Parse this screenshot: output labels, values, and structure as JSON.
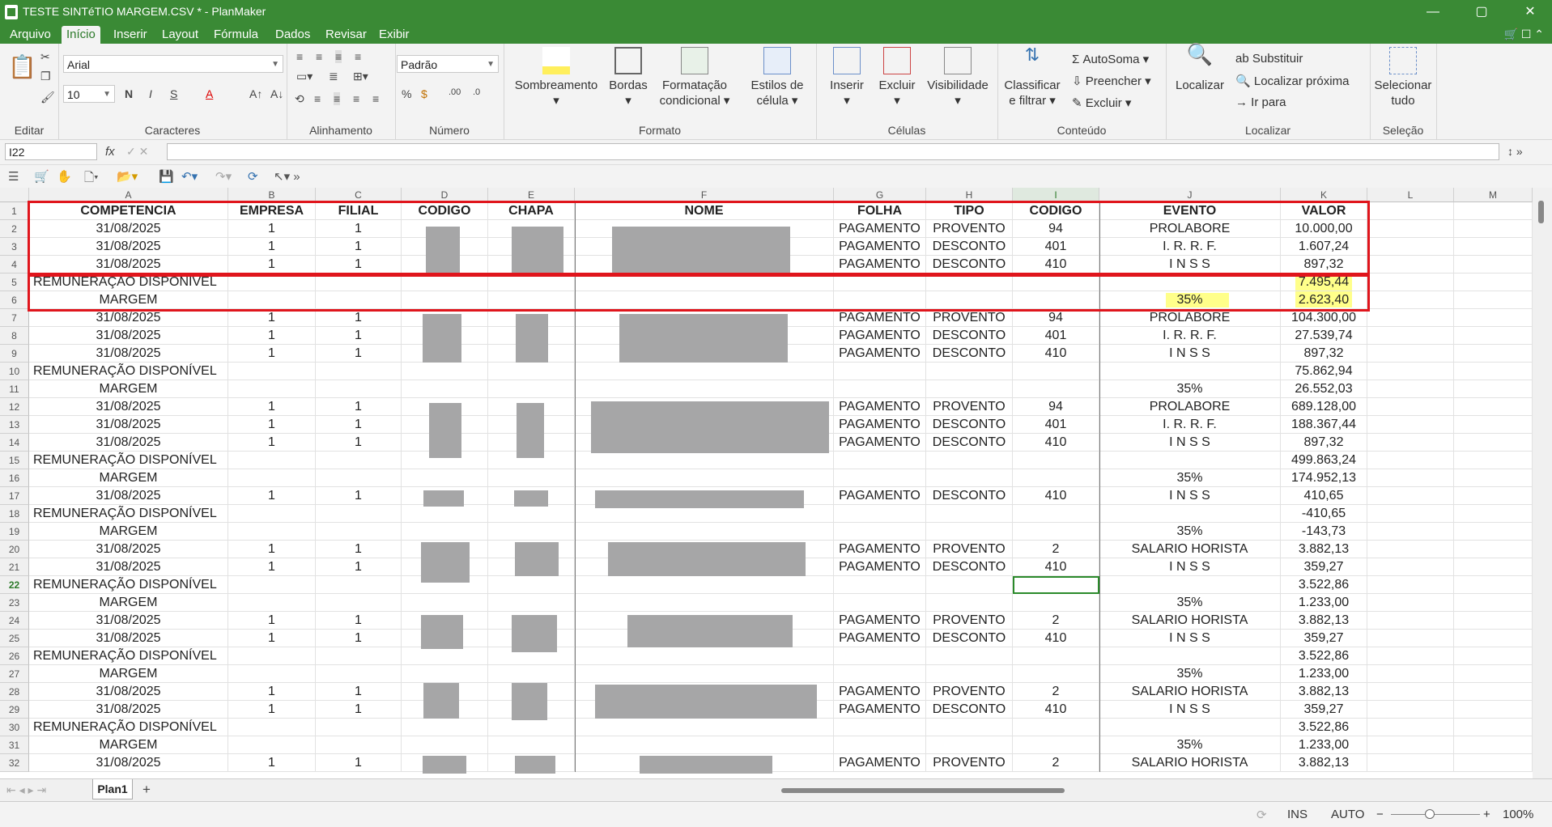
{
  "window": {
    "title": "TESTE SINTéTIO MARGEM.CSV * - PlanMaker"
  },
  "menu": {
    "tabs": [
      "Arquivo",
      "Início",
      "Inserir",
      "Layout",
      "Fórmula",
      "Dados",
      "Revisar",
      "Exibir"
    ],
    "active": "Início"
  },
  "ribbon": {
    "font_name": "Arial",
    "font_size": "10",
    "number_format": "Padrão",
    "buttons": {
      "shading": "Sombreamento",
      "borders": "Bordas",
      "cond_format_1": "Formatação",
      "cond_format_2": "condicional",
      "cell_styles_1": "Estilos de",
      "cell_styles_2": "célula",
      "insert": "Inserir",
      "delete": "Excluir",
      "visibility": "Visibilidade",
      "sort_1": "Classificar",
      "sort_2": "e filtrar",
      "autosum": "AutoSoma",
      "fill": "Preencher",
      "clear": "Excluir",
      "find": "Localizar",
      "replace": "Substituir",
      "find_next": "Localizar próxima",
      "goto": "Ir para",
      "select_all_1": "Selecionar",
      "select_all_2": "tudo"
    },
    "groups": [
      "Editar",
      "Caracteres",
      "Alinhamento",
      "Número",
      "Formato",
      "Células",
      "Conteúdo",
      "Localizar",
      "Seleção"
    ]
  },
  "formula_bar": {
    "cell_ref": "I22",
    "fx": "fx",
    "content": ""
  },
  "sheet": {
    "columns": [
      "A",
      "B",
      "C",
      "D",
      "E",
      "F",
      "G",
      "H",
      "I",
      "J",
      "K",
      "L",
      "M"
    ],
    "selected_column": "I",
    "selected_row": "22",
    "header": [
      "COMPETENCIA",
      "EMPRESA",
      "FILIAL",
      "CODIGO",
      "CHAPA",
      "NOME",
      "FOLHA",
      "TIPO",
      "CODIGO",
      "EVENTO",
      "VALOR"
    ],
    "rows": [
      {
        "n": "2",
        "type": "d",
        "a": "31/08/2025",
        "b": "1",
        "c": "1",
        "g": "PAGAMENTO",
        "h": "PROVENTO",
        "i": "94",
        "j": "PROLABORE",
        "k": "10.000,00"
      },
      {
        "n": "3",
        "type": "d",
        "a": "31/08/2025",
        "b": "1",
        "c": "1",
        "g": "PAGAMENTO",
        "h": "DESCONTO",
        "i": "401",
        "j": "I. R. R. F.",
        "k": "1.607,24"
      },
      {
        "n": "4",
        "type": "d",
        "a": "31/08/2025",
        "b": "1",
        "c": "1",
        "g": "PAGAMENTO",
        "h": "DESCONTO",
        "i": "410",
        "j": "I N S S",
        "k": "897,32"
      },
      {
        "n": "5",
        "type": "r",
        "a": "REMUNERAÇÃO DISPONÍVEL",
        "k": "7.495,44"
      },
      {
        "n": "6",
        "type": "m",
        "a": "MARGEM",
        "j": "35%",
        "k": "2.623,40"
      },
      {
        "n": "7",
        "type": "d",
        "a": "31/08/2025",
        "b": "1",
        "c": "1",
        "g": "PAGAMENTO",
        "h": "PROVENTO",
        "i": "94",
        "j": "PROLABORE",
        "k": "104.300,00"
      },
      {
        "n": "8",
        "type": "d",
        "a": "31/08/2025",
        "b": "1",
        "c": "1",
        "g": "PAGAMENTO",
        "h": "DESCONTO",
        "i": "401",
        "j": "I. R. R. F.",
        "k": "27.539,74"
      },
      {
        "n": "9",
        "type": "d",
        "a": "31/08/2025",
        "b": "1",
        "c": "1",
        "g": "PAGAMENTO",
        "h": "DESCONTO",
        "i": "410",
        "j": "I N S S",
        "k": "897,32"
      },
      {
        "n": "10",
        "type": "r",
        "a": "REMUNERAÇÃO DISPONÍVEL",
        "k": "75.862,94"
      },
      {
        "n": "11",
        "type": "m",
        "a": "MARGEM",
        "j": "35%",
        "k": "26.552,03"
      },
      {
        "n": "12",
        "type": "d",
        "a": "31/08/2025",
        "b": "1",
        "c": "1",
        "g": "PAGAMENTO",
        "h": "PROVENTO",
        "i": "94",
        "j": "PROLABORE",
        "k": "689.128,00"
      },
      {
        "n": "13",
        "type": "d",
        "a": "31/08/2025",
        "b": "1",
        "c": "1",
        "g": "PAGAMENTO",
        "h": "DESCONTO",
        "i": "401",
        "j": "I. R. R. F.",
        "k": "188.367,44"
      },
      {
        "n": "14",
        "type": "d",
        "a": "31/08/2025",
        "b": "1",
        "c": "1",
        "g": "PAGAMENTO",
        "h": "DESCONTO",
        "i": "410",
        "j": "I N S S",
        "k": "897,32"
      },
      {
        "n": "15",
        "type": "r",
        "a": "REMUNERAÇÃO DISPONÍVEL",
        "k": "499.863,24"
      },
      {
        "n": "16",
        "type": "m",
        "a": "MARGEM",
        "j": "35%",
        "k": "174.952,13"
      },
      {
        "n": "17",
        "type": "d",
        "a": "31/08/2025",
        "b": "1",
        "c": "1",
        "g": "PAGAMENTO",
        "h": "DESCONTO",
        "i": "410",
        "j": "I N S S",
        "k": "410,65"
      },
      {
        "n": "18",
        "type": "r",
        "a": "REMUNERAÇÃO DISPONÍVEL",
        "k": "-410,65"
      },
      {
        "n": "19",
        "type": "m",
        "a": "MARGEM",
        "j": "35%",
        "k": "-143,73"
      },
      {
        "n": "20",
        "type": "d",
        "a": "31/08/2025",
        "b": "1",
        "c": "1",
        "g": "PAGAMENTO",
        "h": "PROVENTO",
        "i": "2",
        "j": "SALARIO HORISTA",
        "k": "3.882,13"
      },
      {
        "n": "21",
        "type": "d",
        "a": "31/08/2025",
        "b": "1",
        "c": "1",
        "g": "PAGAMENTO",
        "h": "DESCONTO",
        "i": "410",
        "j": "I N S S",
        "k": "359,27"
      },
      {
        "n": "22",
        "type": "r",
        "a": "REMUNERAÇÃO DISPONÍVEL",
        "k": "3.522,86"
      },
      {
        "n": "23",
        "type": "m",
        "a": "MARGEM",
        "j": "35%",
        "k": "1.233,00"
      },
      {
        "n": "24",
        "type": "d",
        "a": "31/08/2025",
        "b": "1",
        "c": "1",
        "g": "PAGAMENTO",
        "h": "PROVENTO",
        "i": "2",
        "j": "SALARIO HORISTA",
        "k": "3.882,13"
      },
      {
        "n": "25",
        "type": "d",
        "a": "31/08/2025",
        "b": "1",
        "c": "1",
        "g": "PAGAMENTO",
        "h": "DESCONTO",
        "i": "410",
        "j": "I N S S",
        "k": "359,27"
      },
      {
        "n": "26",
        "type": "r",
        "a": "REMUNERAÇÃO DISPONÍVEL",
        "k": "3.522,86"
      },
      {
        "n": "27",
        "type": "m",
        "a": "MARGEM",
        "j": "35%",
        "k": "1.233,00"
      },
      {
        "n": "28",
        "type": "d",
        "a": "31/08/2025",
        "b": "1",
        "c": "1",
        "g": "PAGAMENTO",
        "h": "PROVENTO",
        "i": "2",
        "j": "SALARIO HORISTA",
        "k": "3.882,13"
      },
      {
        "n": "29",
        "type": "d",
        "a": "31/08/2025",
        "b": "1",
        "c": "1",
        "g": "PAGAMENTO",
        "h": "DESCONTO",
        "i": "410",
        "j": "I N S S",
        "k": "359,27"
      },
      {
        "n": "30",
        "type": "r",
        "a": "REMUNERAÇÃO DISPONÍVEL",
        "k": "3.522,86"
      },
      {
        "n": "31",
        "type": "m",
        "a": "MARGEM",
        "j": "35%",
        "k": "1.233,00"
      },
      {
        "n": "32",
        "type": "d",
        "a": "31/08/2025",
        "b": "1",
        "c": "1",
        "g": "PAGAMENTO",
        "h": "PROVENTO",
        "i": "2",
        "j": "SALARIO HORISTA",
        "k": "3.882,13"
      }
    ]
  },
  "sheet_tabs": {
    "active": "Plan1",
    "add": "+"
  },
  "status": {
    "mode": "INS",
    "calc": "AUTO",
    "zoom": "100%"
  },
  "colors": {
    "accent": "#3a8a35",
    "highlight": "#ffff8a",
    "annotation": "#e0151c",
    "redaction": "#a6a6a7"
  }
}
